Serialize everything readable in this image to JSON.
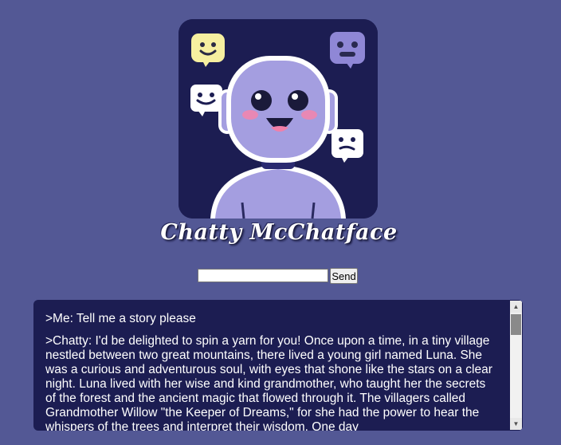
{
  "app": {
    "title": "Chatty McChatface"
  },
  "composer": {
    "input_value": "",
    "send_label": "Send"
  },
  "conversation": [
    {
      "speaker": "Me",
      "text": ">Me: Tell me a story please"
    },
    {
      "speaker": "Chatty",
      "text": ">Chatty: I'd be delighted to spin a yarn for you! Once upon a time, in a tiny village nestled between two great mountains, there lived a young girl named Luna. She was a curious and adventurous soul, with eyes that shone like the stars on a clear night. Luna lived with her wise and kind grandmother, who taught her the secrets of the forest and the ancient magic that flowed through it. The villagers called Grandmother Willow \"the Keeper of Dreams,\" for she had the power to hear the whispers of the trees and interpret their wisdom. One day"
    }
  ],
  "scrollbar": {
    "up_icon": "▲",
    "down_icon": "▼"
  },
  "colors": {
    "background": "#535895",
    "panel": "#1c1d52",
    "robot": "#a49ee0"
  }
}
